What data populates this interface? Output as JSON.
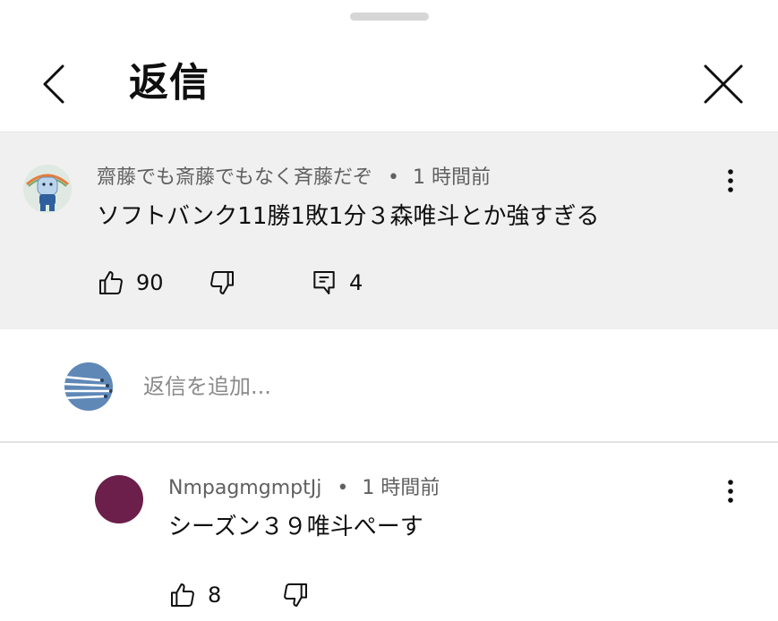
{
  "header": {
    "title": "返信",
    "back_icon": "chevron-left-icon",
    "close_icon": "close-icon"
  },
  "parent_comment": {
    "author": "齋藤でも斎藤でもなく斉藤だぞ",
    "separator": "•",
    "time": "1 時間前",
    "text": "ソフトバンク11勝1敗1分３森唯斗とか強すぎる",
    "likes": "90",
    "replies": "4",
    "icons": [
      "thumbs-up-icon",
      "thumbs-down-icon",
      "reply-icon",
      "more-vert-icon"
    ]
  },
  "add_reply": {
    "placeholder": "返信を追加..."
  },
  "replies": [
    {
      "author": "NmpagmgmptJj",
      "separator": "•",
      "time": "1 時間前",
      "text": "シーズン３９唯斗ぺーす",
      "likes": "8",
      "avatar_color": "#6b1f4a"
    }
  ],
  "colors": {
    "highlight_bg": "#f0f0f0",
    "secondary_text": "#606060",
    "primary_text": "#0f0f0f",
    "placeholder": "#8a8a8a"
  }
}
